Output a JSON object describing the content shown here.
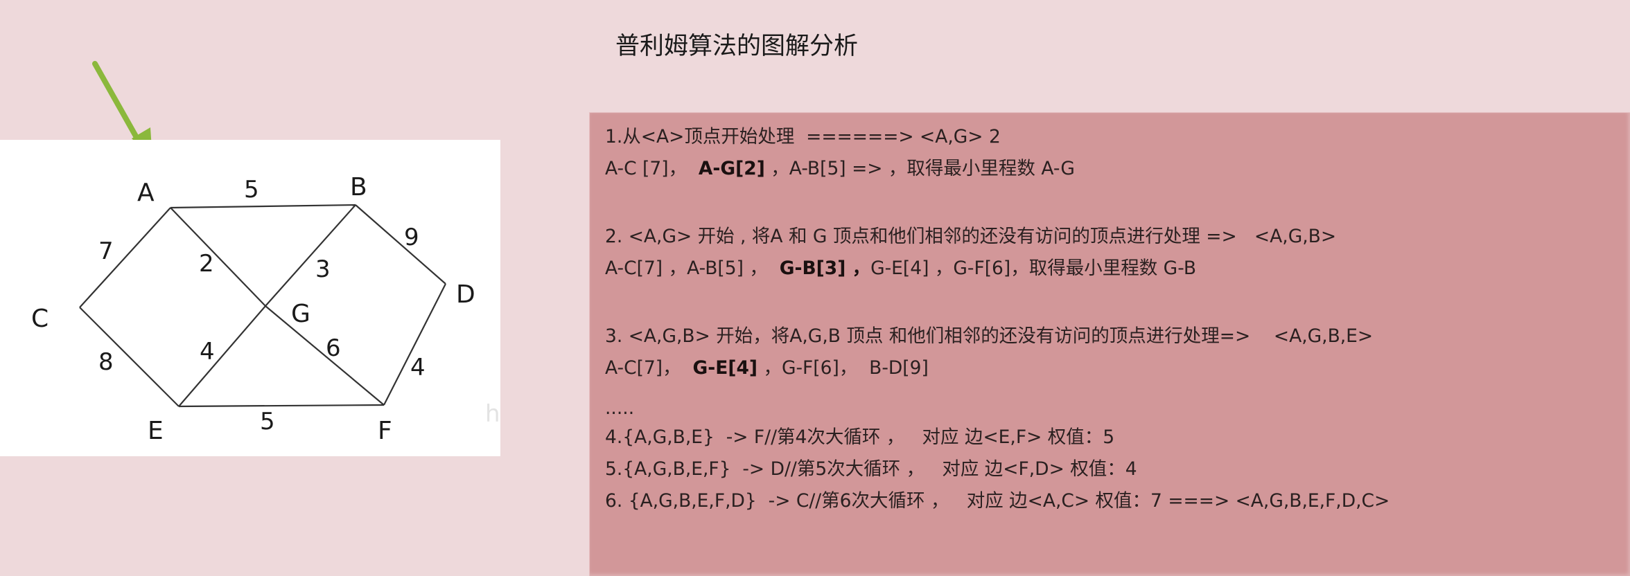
{
  "title": "普利姆算法的图解分析",
  "graph": {
    "nodes": [
      {
        "id": "A",
        "label": "A"
      },
      {
        "id": "B",
        "label": "B"
      },
      {
        "id": "C",
        "label": "C"
      },
      {
        "id": "D",
        "label": "D"
      },
      {
        "id": "E",
        "label": "E"
      },
      {
        "id": "F",
        "label": "F"
      },
      {
        "id": "G",
        "label": "G"
      }
    ],
    "edges": [
      {
        "from": "A",
        "to": "B",
        "weight": "5"
      },
      {
        "from": "A",
        "to": "C",
        "weight": "7"
      },
      {
        "from": "A",
        "to": "G",
        "weight": "2"
      },
      {
        "from": "B",
        "to": "G",
        "weight": "3"
      },
      {
        "from": "B",
        "to": "D",
        "weight": "9"
      },
      {
        "from": "C",
        "to": "E",
        "weight": "8"
      },
      {
        "from": "E",
        "to": "G",
        "weight": "4"
      },
      {
        "from": "G",
        "to": "F",
        "weight": "6"
      },
      {
        "from": "D",
        "to": "F",
        "weight": "4"
      },
      {
        "from": "E",
        "to": "F",
        "weight": "5"
      }
    ],
    "start_arrow_color": "#8bb83c",
    "watermark": "h"
  },
  "steps": [
    [
      {
        "t": "1.从<A>顶点开始处理  ======> <A,G> 2",
        "b": false
      }
    ],
    [
      {
        "t": "A-C [7]，  ",
        "b": false
      },
      {
        "t": "A-G[2]",
        "b": true
      },
      {
        "t": " ，A-B[5] => ，取得最小里程数 A-G",
        "b": false
      }
    ],
    [
      {
        "t": "2. <A,G> 开始 , 将A 和 G 顶点和他们相邻的还没有访问的顶点进行处理 =>   <A,G,B>",
        "b": false
      }
    ],
    [
      {
        "t": "A-C[7] ，A-B[5] ，  ",
        "b": false
      },
      {
        "t": "G-B[3] ，",
        "b": true
      },
      {
        "t": "G-E[4] ，G-F[6]，取得最小里程数 G-B",
        "b": false
      }
    ],
    [
      {
        "t": "3. <A,G,B> 开始，将A,G,B 顶点 和他们相邻的还没有访问的顶点进行处理=>    <A,G,B,E>",
        "b": false
      }
    ],
    [
      {
        "t": "A-C[7]，  ",
        "b": false
      },
      {
        "t": "G-E[4]",
        "b": true
      },
      {
        "t": " ，G-F[6]，  B-D[9]",
        "b": false
      }
    ],
    [
      {
        "t": ".....",
        "b": false
      }
    ],
    [
      {
        "t": "4.{A,G,B,E}  -> F//第4次大循环 ，   对应 边<E,F> 权值：5",
        "b": false
      }
    ],
    [
      {
        "t": "5.{A,G,B,E,F}  -> D//第5次大循环 ，   对应 边<F,D> 权值：4",
        "b": false
      }
    ],
    [
      {
        "t": "6. {A,G,B,E,F,D}  -> C//第6次大循环 ，   对应 边<A,C> 权值：7 ===> <A,G,B,E,F,D,C>",
        "b": false
      }
    ]
  ]
}
